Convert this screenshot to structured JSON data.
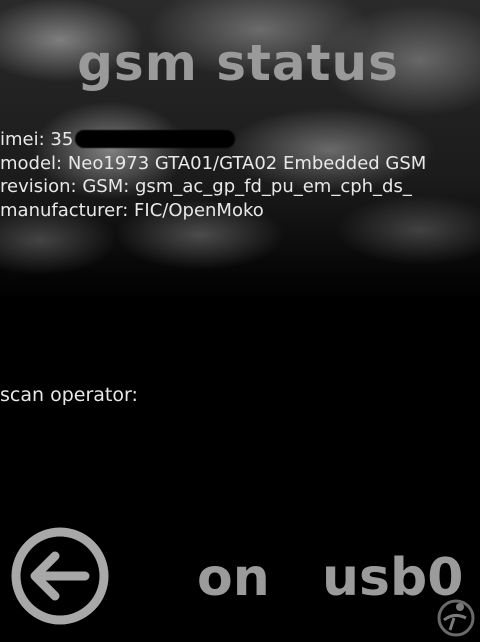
{
  "header": {
    "title": "gsm status"
  },
  "info": {
    "imei_label": "imei: 35",
    "model": "model: Neo1973 GTA01/GTA02 Embedded GSM",
    "revision": "revision: GSM: gsm_ac_gp_fd_pu_em_cph_ds_",
    "manufacturer": "manufacturer: FIC/OpenMoko"
  },
  "scan": {
    "label": "scan operator:"
  },
  "footer": {
    "on_label": "on",
    "usb_label": "usb0"
  },
  "icons": {
    "back": "back-arrow-icon",
    "logo": "openmoko-logo-icon"
  },
  "colors": {
    "background": "#000000",
    "title": "#9a9a9a",
    "text": "#e8e8e8",
    "buttons": "#9b9b9b"
  }
}
